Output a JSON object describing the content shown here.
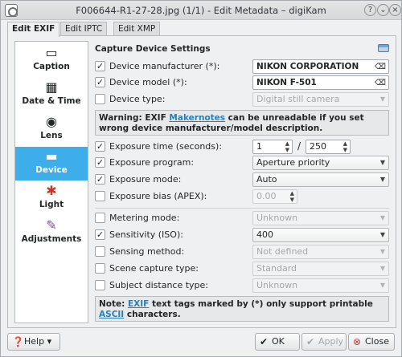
{
  "window": {
    "title": "F006644-R1-27-28.jpg (1/1) - Edit Metadata – digiKam"
  },
  "tabs": [
    {
      "label": "Edit EXIF"
    },
    {
      "label": "Edit IPTC"
    },
    {
      "label": "Edit XMP"
    }
  ],
  "sidebar": {
    "items": [
      {
        "label": "Caption",
        "icon": "caption-icon"
      },
      {
        "label": "Date & Time",
        "icon": "calendar-icon"
      },
      {
        "label": "Lens",
        "icon": "lens-icon"
      },
      {
        "label": "Device",
        "icon": "scanner-icon"
      },
      {
        "label": "Light",
        "icon": "light-icon"
      },
      {
        "label": "Adjustments",
        "icon": "adjustments-icon"
      }
    ],
    "selected": "Device"
  },
  "section": {
    "title": "Capture Device Settings"
  },
  "fields": {
    "manufacturer": {
      "label": "Device manufacturer (*):",
      "value": "NIKON CORPORATION",
      "checked": true
    },
    "model": {
      "label": "Device model (*):",
      "value": "NIKON F-501",
      "checked": true
    },
    "type": {
      "label": "Device type:",
      "value": "Digital still camera",
      "checked": false
    },
    "exposure_time": {
      "label": "Exposure time (seconds):",
      "numerator": "1",
      "slash": "/",
      "denominator": "250",
      "checked": true
    },
    "exposure_program": {
      "label": "Exposure program:",
      "value": "Aperture priority",
      "checked": true
    },
    "exposure_mode": {
      "label": "Exposure mode:",
      "value": "Auto",
      "checked": true
    },
    "exposure_bias": {
      "label": "Exposure bias (APEX):",
      "value": "0.00",
      "checked": false
    },
    "metering_mode": {
      "label": "Metering mode:",
      "value": "Unknown",
      "checked": false
    },
    "sensitivity": {
      "label": "Sensitivity (ISO):",
      "value": "400",
      "checked": true
    },
    "sensing_method": {
      "label": "Sensing method:",
      "value": "Not defined",
      "checked": false
    },
    "scene_capture": {
      "label": "Scene capture type:",
      "value": "Standard",
      "checked": false
    },
    "subject_distance": {
      "label": "Subject distance type:",
      "value": "Unknown",
      "checked": false
    }
  },
  "warning": {
    "prefix": "Warning: EXIF ",
    "link": "Makernotes",
    "suffix": " can be unreadable if you set wrong device manufacturer/model description."
  },
  "note": {
    "prefix": "Note: ",
    "link1": "EXIF",
    "middle": " text tags marked by (*) only support printable ",
    "link2": "ASCII",
    "suffix": " characters."
  },
  "buttons": {
    "help": "Help",
    "ok": "OK",
    "apply": "Apply",
    "close": "Close"
  },
  "check_glyph": "✓"
}
